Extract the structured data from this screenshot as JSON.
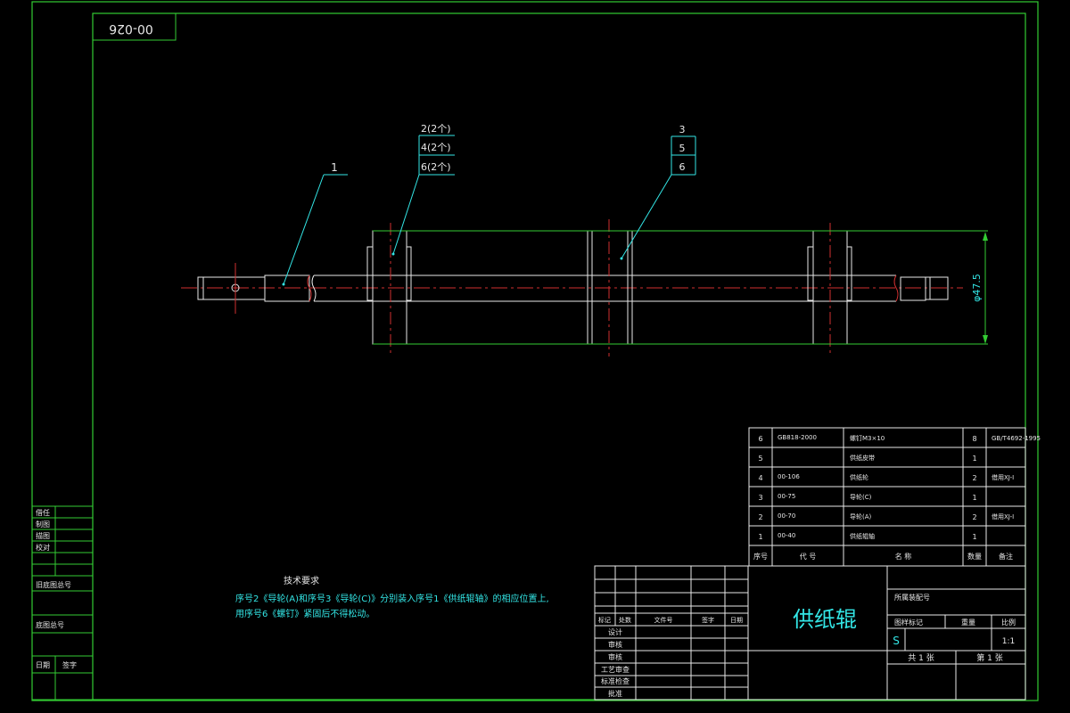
{
  "drawing_number": "00-026",
  "callouts": {
    "c1": "1",
    "c2": "2(2个)",
    "c4": "4(2个)",
    "c6": "6(2个)",
    "c3": "3",
    "c5": "5",
    "c6b": "6"
  },
  "dimension": "φ47.5",
  "tech_req": {
    "title": "技术要求",
    "line1": "序号2《导轮(A)和序号3《导轮(C)》分别装入序号1《供纸辊轴》的相应位置上,",
    "line2": "用序号6《螺钉》紧固后不得松动。"
  },
  "bom": {
    "rows": [
      {
        "no": "6",
        "code": "GB818-2000",
        "name": "螺钉M3×10",
        "qty": "8",
        "remark": "GB/T4692-1995"
      },
      {
        "no": "5",
        "code": "",
        "name": "供纸皮带",
        "qty": "1",
        "remark": ""
      },
      {
        "no": "4",
        "code": "00-106",
        "name": "供纸轮",
        "qty": "2",
        "remark": "借用XJ-I"
      },
      {
        "no": "3",
        "code": "00-75",
        "name": "导轮(C)",
        "qty": "1",
        "remark": ""
      },
      {
        "no": "2",
        "code": "00-70",
        "name": "导轮(A)",
        "qty": "2",
        "remark": "借用XJ-I"
      },
      {
        "no": "1",
        "code": "00-40",
        "name": "供纸辊轴",
        "qty": "1",
        "remark": ""
      }
    ],
    "header": {
      "no": "序号",
      "code": "代  号",
      "name": "名   称",
      "qty": "数量",
      "remark": "备注"
    }
  },
  "left_strip": {
    "r1": "借任",
    "r2": "制图",
    "r3": "描图",
    "r4": "校对",
    "base": "旧底图总号",
    "sign": "底图总号",
    "date": "日期",
    "signature": "签字"
  },
  "title_block": {
    "title": "供纸辊",
    "assembly_label": "所属装配号",
    "stage_label": "图样标记",
    "weight_label": "重量",
    "scale_label": "比例",
    "stage": "S",
    "scale": "1:1",
    "sheets_total": "共 1 张",
    "sheet_no": "第 1 张",
    "rev_headers": [
      "标记",
      "处数",
      "文件号",
      "签字",
      "日期"
    ],
    "roles": [
      "设计",
      "审核",
      "审核",
      "工艺审查",
      "标准检查",
      "批准"
    ]
  }
}
